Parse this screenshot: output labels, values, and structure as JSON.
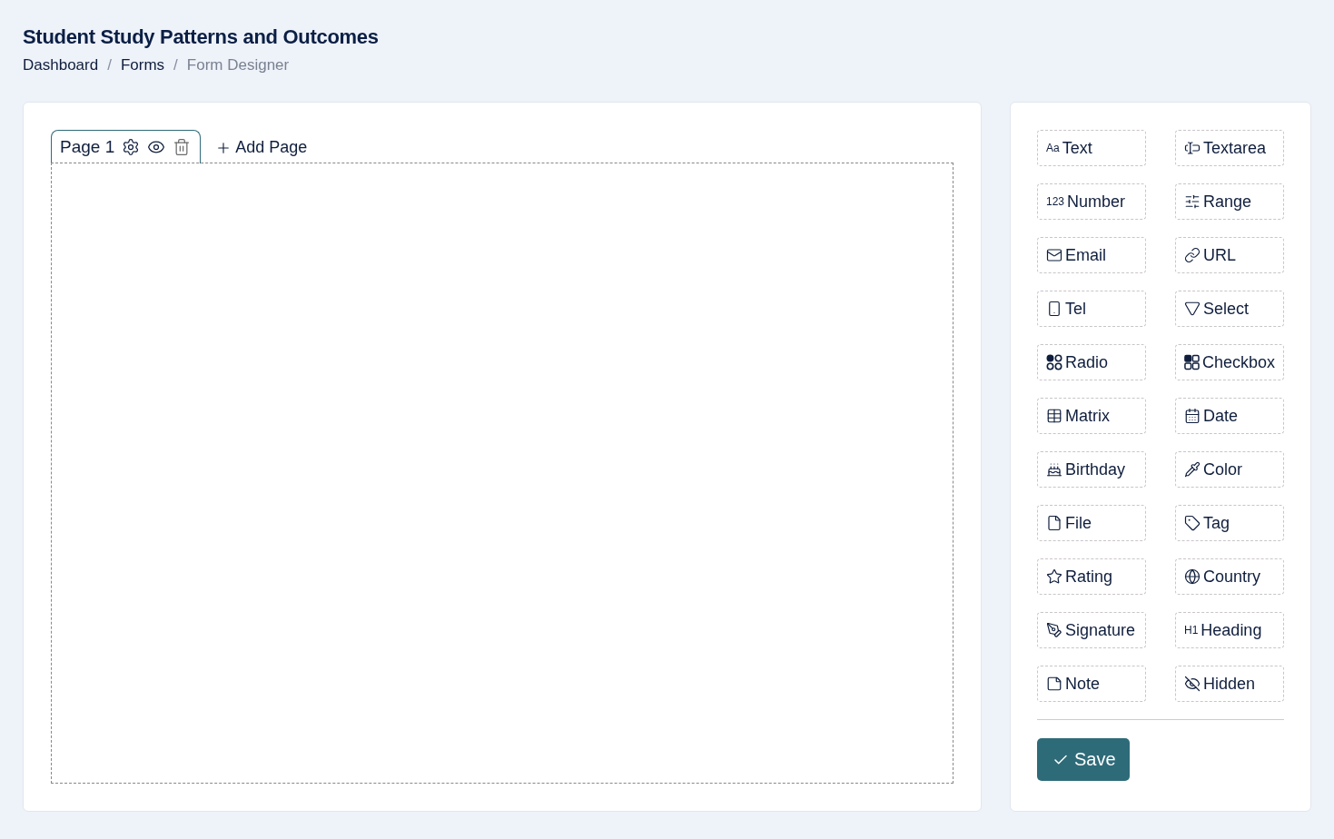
{
  "header": {
    "title": "Student Study Patterns and Outcomes",
    "separator": "/",
    "breadcrumb": [
      {
        "label": "Dashboard",
        "current": false
      },
      {
        "label": "Forms",
        "current": false
      },
      {
        "label": "Form Designer",
        "current": true
      }
    ]
  },
  "pages": {
    "tabs": [
      {
        "label": "Page 1",
        "selected": true
      }
    ],
    "add_label": "Add Page"
  },
  "palette": [
    {
      "kind": "text",
      "label": "Text",
      "icon_text": "Aa"
    },
    {
      "kind": "textarea",
      "label": "Textarea"
    },
    {
      "kind": "number",
      "label": "Number",
      "icon_text": "123"
    },
    {
      "kind": "range",
      "label": "Range"
    },
    {
      "kind": "email",
      "label": "Email"
    },
    {
      "kind": "url",
      "label": "URL"
    },
    {
      "kind": "tel",
      "label": "Tel"
    },
    {
      "kind": "select",
      "label": "Select"
    },
    {
      "kind": "radio",
      "label": "Radio"
    },
    {
      "kind": "checkbox",
      "label": "Checkbox"
    },
    {
      "kind": "matrix",
      "label": "Matrix"
    },
    {
      "kind": "date",
      "label": "Date"
    },
    {
      "kind": "birthday",
      "label": "Birthday"
    },
    {
      "kind": "color",
      "label": "Color"
    },
    {
      "kind": "file",
      "label": "File"
    },
    {
      "kind": "tag",
      "label": "Tag"
    },
    {
      "kind": "rating",
      "label": "Rating"
    },
    {
      "kind": "country",
      "label": "Country"
    },
    {
      "kind": "signature",
      "label": "Signature"
    },
    {
      "kind": "heading",
      "label": "Heading",
      "icon_text": "H1"
    },
    {
      "kind": "note",
      "label": "Note"
    },
    {
      "kind": "hidden",
      "label": "Hidden"
    }
  ],
  "save_label": "Save"
}
